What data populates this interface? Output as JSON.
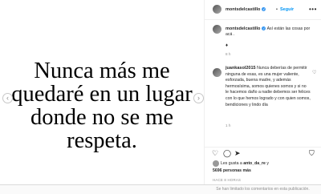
{
  "post": {
    "quote": "Nunca más me quedaré en un lugar donde no se me respeta.",
    "nav_left": "‹",
    "nav_right": "›"
  },
  "header": {
    "username": "montsdelcastillo",
    "verified_icon": "✓",
    "separator": "•",
    "follow_label": "Seguir",
    "more_icon": "•••"
  },
  "caption": {
    "username": "montsdelcastillo",
    "text": "Así están las cosas por acá .",
    "diamond": "♦",
    "time": "8 h"
  },
  "comment": {
    "username": "juankasol2015",
    "text": "Nunca deberías de permitir ninguna de esas, es una mujer valiente, esforzada, buena madre, y además hermosísima, somos quienes somos y si no le hacemos daño a nadie debemos ser felices con lo que hemos logrado y con quien somos, bendiciones y lindo día",
    "time": "1 h",
    "heart_icon": "♡"
  },
  "actions": {
    "like_icon": "♡",
    "comment_icon": "◯",
    "share_icon": "➤",
    "save_icon": "⛉"
  },
  "likes": {
    "liked_by_prefix": "Les gusta a ",
    "liked_by_user": "anto_da_re",
    "and": " y",
    "count": "5696 personas más"
  },
  "time_ago": "HACE 8 HORAS",
  "comments_limited": "Se han limitado los comentarios en esta publicación."
}
